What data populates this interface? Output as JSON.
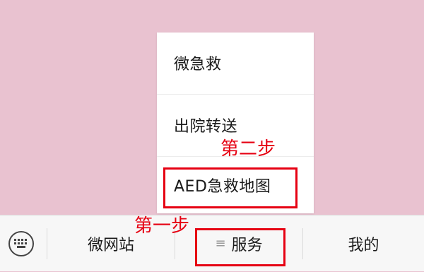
{
  "popup_menu": {
    "items": [
      {
        "label": "微急救"
      },
      {
        "label": "出院转送"
      },
      {
        "label": "AED急救地图"
      }
    ]
  },
  "bottom_bar": {
    "keyboard_icon": "keyboard-icon",
    "tabs": [
      {
        "label": "微网站"
      },
      {
        "label": "服务",
        "icon": "menu-lines-icon"
      },
      {
        "label": "我的"
      }
    ]
  },
  "annotations": {
    "step1": "第一步",
    "step2": "第二步",
    "highlight_color": "#e60012"
  },
  "colors": {
    "background": "#e9c2d0",
    "menu_background": "#ffffff",
    "bar_background": "#f7f7f7"
  }
}
